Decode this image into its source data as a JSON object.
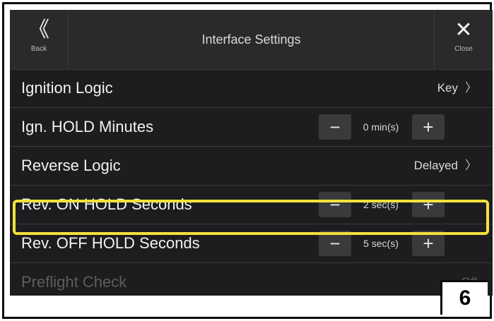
{
  "header": {
    "back_glyph": "《",
    "back_label": "Back",
    "title": "Interface Settings",
    "close_glyph": "✕",
    "close_label": "Close"
  },
  "rows": [
    {
      "label": "Ignition Logic",
      "value": "Key",
      "chevron": "〉"
    },
    {
      "label": "Ign. HOLD Minutes",
      "minus": "−",
      "value": "0 min(s)",
      "plus": "+"
    },
    {
      "label": "Reverse Logic",
      "value": "Delayed",
      "chevron": "〉"
    },
    {
      "label": "Rev. ON HOLD Seconds",
      "minus": "−",
      "value": "2 sec(s)",
      "plus": "+"
    },
    {
      "label": "Rev. OFF HOLD Seconds",
      "minus": "−",
      "value": "5 sec(s)",
      "plus": "+"
    },
    {
      "label": "Preflight Check",
      "value": "Off"
    }
  ],
  "highlight_color": "#f2e23c",
  "step_number": "6"
}
